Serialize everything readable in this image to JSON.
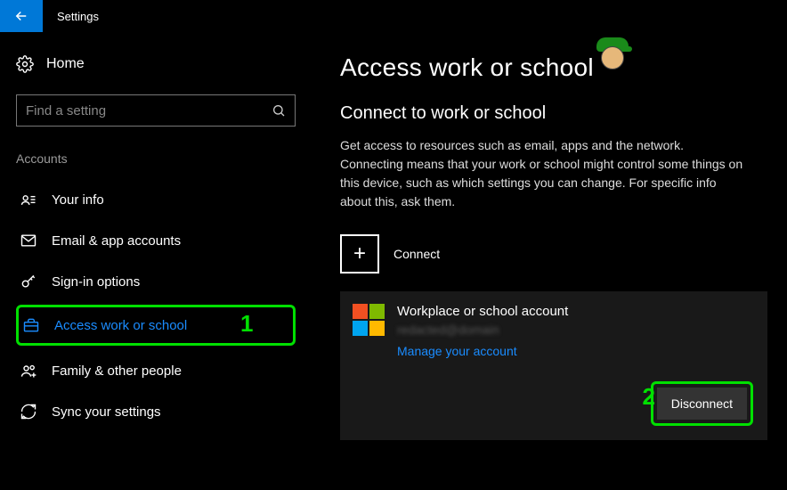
{
  "header": {
    "title": "Settings"
  },
  "sidebar": {
    "home_label": "Home",
    "search_placeholder": "Find a setting",
    "section_label": "Accounts",
    "items": [
      {
        "label": "Your info",
        "icon": "user-card-icon"
      },
      {
        "label": "Email & app accounts",
        "icon": "mail-icon"
      },
      {
        "label": "Sign-in options",
        "icon": "key-icon"
      },
      {
        "label": "Access work or school",
        "icon": "briefcase-icon"
      },
      {
        "label": "Family & other people",
        "icon": "people-icon"
      },
      {
        "label": "Sync your settings",
        "icon": "sync-icon"
      }
    ]
  },
  "main": {
    "page_title": "Access work or school",
    "section_title": "Connect to work or school",
    "description": "Get access to resources such as email, apps and the network. Connecting means that your work or school might control some things on this device, such as which settings you can change. For specific info about this, ask them.",
    "connect_label": "Connect",
    "account": {
      "title": "Workplace or school account",
      "subtitle": "redacted@domain",
      "manage_link": "Manage your account",
      "disconnect_label": "Disconnect"
    }
  },
  "annotations": {
    "marker1": "1",
    "marker2": "2"
  }
}
